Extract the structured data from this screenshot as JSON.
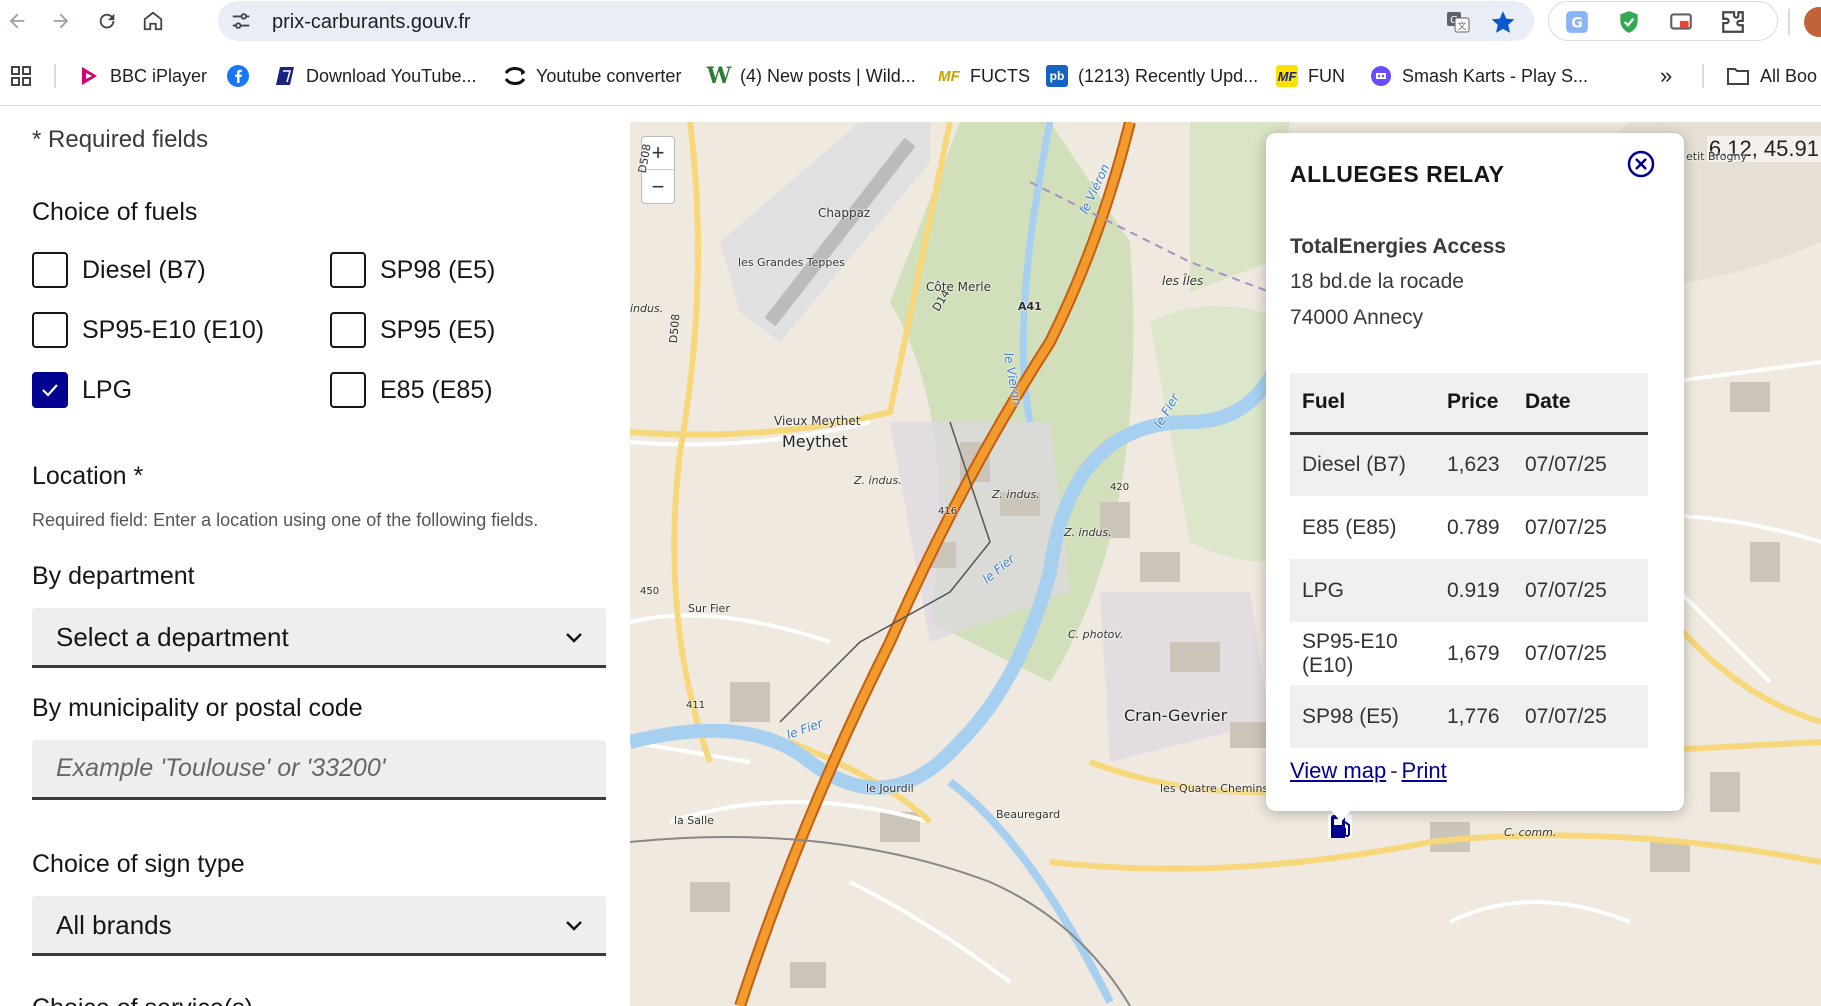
{
  "browser": {
    "url": "prix-carburants.gouv.fr",
    "bookmarks": [
      {
        "label": "BBC iPlayer",
        "icon": "bbc-iplayer-icon"
      },
      {
        "label": "",
        "icon": "facebook-icon"
      },
      {
        "label": "Download YouTube...",
        "icon": "download-youtube-icon"
      },
      {
        "label": "Youtube converter",
        "icon": "youtube-converter-icon"
      },
      {
        "label": "(4) New posts | Wild...",
        "icon": "wild-forum-icon"
      },
      {
        "label": "FUCTS",
        "icon": "mf-icon"
      },
      {
        "label": "(1213) Recently Upd...",
        "icon": "pb-icon"
      },
      {
        "label": "FUN",
        "icon": "mf-icon"
      },
      {
        "label": "Smash Karts - Play S...",
        "icon": "smash-karts-icon"
      }
    ],
    "overflow": "»",
    "all_bookmarks": "All Boo"
  },
  "form": {
    "required_note": "* Required fields",
    "fuel_title": "Choice of fuels",
    "fuels": [
      {
        "label": "Diesel (B7)",
        "checked": false
      },
      {
        "label": "SP98 (E5)",
        "checked": false
      },
      {
        "label": "SP95-E10 (E10)",
        "checked": false
      },
      {
        "label": "SP95 (E5)",
        "checked": false
      },
      {
        "label": "LPG",
        "checked": true
      },
      {
        "label": "E85 (E85)",
        "checked": false
      }
    ],
    "location_title": "Location *",
    "location_hint": "Required field: Enter a location using one of the following fields.",
    "department_title": "By department",
    "department_value": "Select a department",
    "municipality_title": "By municipality or postal code",
    "municipality_placeholder": "Example 'Toulouse' or '33200'",
    "sign_title": "Choice of sign type",
    "sign_value": "All brands",
    "next_title": "Choice of service(s)"
  },
  "map": {
    "zoom_in": "+",
    "zoom_out": "−",
    "coords": "6.12, 45.91",
    "labels": {
      "chappaz": "Chappaz",
      "grandes_teppes": "les Grandes Teppes",
      "cote_merle": "Côte Merle",
      "les_iles": "les Îles",
      "vieux_meythet": "Vieux Meythet",
      "meythet": "Meythet",
      "z_indus_1": "Z. indus.",
      "z_indus_2": "Z. indus.",
      "z_indus_3": "Z. indus.",
      "indus": "indus.",
      "sur_fier": "Sur Fier",
      "c_photov": "C. photov.",
      "cran_gevrier": "Cran-Gevrier",
      "le_jourdil": "le Jourdil",
      "la_salle": "la Salle",
      "beauregard": "Beauregard",
      "quatre_chemins": "les Quatre Chemins",
      "c_comm": "C. comm.",
      "petit_brogny": "etit Brogny",
      "d14": "D14",
      "d508": "D508",
      "d508b": "D508",
      "a41": "A41",
      "r416": "416",
      "r420": "420",
      "r450": "450",
      "r411": "411",
      "le_fier_1": "le Fier",
      "le_fier_2": "le Fier",
      "le_fier_3": "le Fier",
      "le_vieron_1": "le Viéron",
      "le_vieron_2": "le Viéron"
    }
  },
  "popup": {
    "title": "ALLUEGES RELAY",
    "brand": "TotalEnergies Access",
    "address_line1": "18 bd.de la rocade",
    "address_line2": "74000 Annecy",
    "table": {
      "headers": {
        "fuel": "Fuel",
        "price": "Price",
        "date": "Date"
      },
      "rows": [
        {
          "fuel": "Diesel (B7)",
          "price": "1,623",
          "date": "07/07/25"
        },
        {
          "fuel": "E85 (E85)",
          "price": "0.789",
          "date": "07/07/25"
        },
        {
          "fuel": "LPG",
          "price": "0.919",
          "date": "07/07/25"
        },
        {
          "fuel": "SP95-E10 (E10)",
          "price": "1,679",
          "date": "07/07/25"
        },
        {
          "fuel": "SP98 (E5)",
          "price": "1,776",
          "date": "07/07/25"
        }
      ]
    },
    "link_view_map": "View map",
    "link_separator": "-",
    "link_print": "Print"
  },
  "colors": {
    "accent": "#000091",
    "star": "#0b57d0",
    "motorway": "#f39a2f"
  }
}
